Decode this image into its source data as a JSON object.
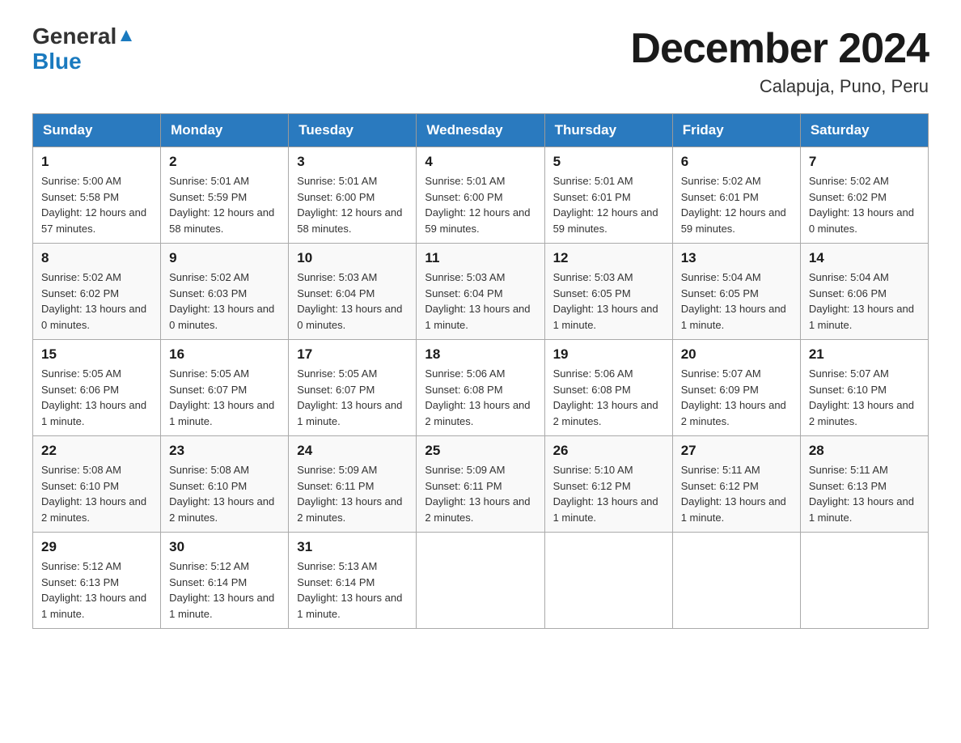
{
  "header": {
    "logo_general": "General",
    "logo_blue": "Blue",
    "title": "December 2024",
    "subtitle": "Calapuja, Puno, Peru"
  },
  "days_of_week": [
    "Sunday",
    "Monday",
    "Tuesday",
    "Wednesday",
    "Thursday",
    "Friday",
    "Saturday"
  ],
  "weeks": [
    [
      {
        "day": "1",
        "sunrise": "5:00 AM",
        "sunset": "5:58 PM",
        "daylight": "12 hours and 57 minutes."
      },
      {
        "day": "2",
        "sunrise": "5:01 AM",
        "sunset": "5:59 PM",
        "daylight": "12 hours and 58 minutes."
      },
      {
        "day": "3",
        "sunrise": "5:01 AM",
        "sunset": "6:00 PM",
        "daylight": "12 hours and 58 minutes."
      },
      {
        "day": "4",
        "sunrise": "5:01 AM",
        "sunset": "6:00 PM",
        "daylight": "12 hours and 59 minutes."
      },
      {
        "day": "5",
        "sunrise": "5:01 AM",
        "sunset": "6:01 PM",
        "daylight": "12 hours and 59 minutes."
      },
      {
        "day": "6",
        "sunrise": "5:02 AM",
        "sunset": "6:01 PM",
        "daylight": "12 hours and 59 minutes."
      },
      {
        "day": "7",
        "sunrise": "5:02 AM",
        "sunset": "6:02 PM",
        "daylight": "13 hours and 0 minutes."
      }
    ],
    [
      {
        "day": "8",
        "sunrise": "5:02 AM",
        "sunset": "6:02 PM",
        "daylight": "13 hours and 0 minutes."
      },
      {
        "day": "9",
        "sunrise": "5:02 AM",
        "sunset": "6:03 PM",
        "daylight": "13 hours and 0 minutes."
      },
      {
        "day": "10",
        "sunrise": "5:03 AM",
        "sunset": "6:04 PM",
        "daylight": "13 hours and 0 minutes."
      },
      {
        "day": "11",
        "sunrise": "5:03 AM",
        "sunset": "6:04 PM",
        "daylight": "13 hours and 1 minute."
      },
      {
        "day": "12",
        "sunrise": "5:03 AM",
        "sunset": "6:05 PM",
        "daylight": "13 hours and 1 minute."
      },
      {
        "day": "13",
        "sunrise": "5:04 AM",
        "sunset": "6:05 PM",
        "daylight": "13 hours and 1 minute."
      },
      {
        "day": "14",
        "sunrise": "5:04 AM",
        "sunset": "6:06 PM",
        "daylight": "13 hours and 1 minute."
      }
    ],
    [
      {
        "day": "15",
        "sunrise": "5:05 AM",
        "sunset": "6:06 PM",
        "daylight": "13 hours and 1 minute."
      },
      {
        "day": "16",
        "sunrise": "5:05 AM",
        "sunset": "6:07 PM",
        "daylight": "13 hours and 1 minute."
      },
      {
        "day": "17",
        "sunrise": "5:05 AM",
        "sunset": "6:07 PM",
        "daylight": "13 hours and 1 minute."
      },
      {
        "day": "18",
        "sunrise": "5:06 AM",
        "sunset": "6:08 PM",
        "daylight": "13 hours and 2 minutes."
      },
      {
        "day": "19",
        "sunrise": "5:06 AM",
        "sunset": "6:08 PM",
        "daylight": "13 hours and 2 minutes."
      },
      {
        "day": "20",
        "sunrise": "5:07 AM",
        "sunset": "6:09 PM",
        "daylight": "13 hours and 2 minutes."
      },
      {
        "day": "21",
        "sunrise": "5:07 AM",
        "sunset": "6:10 PM",
        "daylight": "13 hours and 2 minutes."
      }
    ],
    [
      {
        "day": "22",
        "sunrise": "5:08 AM",
        "sunset": "6:10 PM",
        "daylight": "13 hours and 2 minutes."
      },
      {
        "day": "23",
        "sunrise": "5:08 AM",
        "sunset": "6:10 PM",
        "daylight": "13 hours and 2 minutes."
      },
      {
        "day": "24",
        "sunrise": "5:09 AM",
        "sunset": "6:11 PM",
        "daylight": "13 hours and 2 minutes."
      },
      {
        "day": "25",
        "sunrise": "5:09 AM",
        "sunset": "6:11 PM",
        "daylight": "13 hours and 2 minutes."
      },
      {
        "day": "26",
        "sunrise": "5:10 AM",
        "sunset": "6:12 PM",
        "daylight": "13 hours and 1 minute."
      },
      {
        "day": "27",
        "sunrise": "5:11 AM",
        "sunset": "6:12 PM",
        "daylight": "13 hours and 1 minute."
      },
      {
        "day": "28",
        "sunrise": "5:11 AM",
        "sunset": "6:13 PM",
        "daylight": "13 hours and 1 minute."
      }
    ],
    [
      {
        "day": "29",
        "sunrise": "5:12 AM",
        "sunset": "6:13 PM",
        "daylight": "13 hours and 1 minute."
      },
      {
        "day": "30",
        "sunrise": "5:12 AM",
        "sunset": "6:14 PM",
        "daylight": "13 hours and 1 minute."
      },
      {
        "day": "31",
        "sunrise": "5:13 AM",
        "sunset": "6:14 PM",
        "daylight": "13 hours and 1 minute."
      },
      null,
      null,
      null,
      null
    ]
  ]
}
